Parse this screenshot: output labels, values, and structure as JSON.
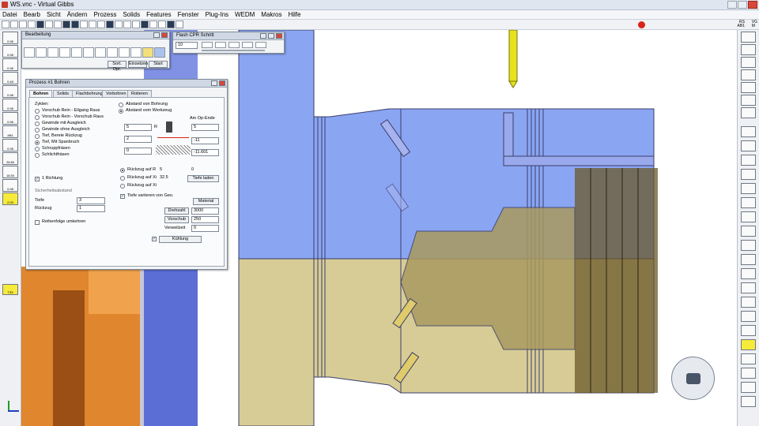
{
  "window": {
    "title": "WS.vnc - Virtual Gibbs"
  },
  "menu": [
    "Datei",
    "Bearb",
    "Sicht",
    "Ändern",
    "Prozess",
    "Solids",
    "Features",
    "Fenster",
    "Plug-Ins",
    "WEDM",
    "Makros",
    "Hilfe"
  ],
  "status": {
    "line1": "RS",
    "line2": "AB1",
    "line3": "VG",
    "line4": "M"
  },
  "left_tools": [
    {
      "label": "0.98"
    },
    {
      "label": "0.98"
    },
    {
      "label": "0.98"
    },
    {
      "label": "0.48"
    },
    {
      "label": "0.98"
    },
    {
      "label": "0.98"
    },
    {
      "label": "0.98"
    },
    {
      "label": "AB1"
    },
    {
      "label": "0.98"
    },
    {
      "label": "26.80"
    },
    {
      "label": "18.50"
    },
    {
      "label": "0.98"
    },
    {
      "label": "2.00"
    }
  ],
  "tool_indicator": {
    "label": "T33"
  },
  "bearbeitung": {
    "title": "Bearbeitung",
    "sort_label": "Sort. Opr.",
    "insert_label": "Einsetzen",
    "start_label": "Start"
  },
  "flash_panel": {
    "title": "Flash CPR Schritt",
    "speed": "10"
  },
  "prozess": {
    "title": "Prozess #1 Bohren",
    "tabs": [
      "Bohren",
      "Solids",
      "Flachbohrung",
      "Vorbohren",
      "Rotieren"
    ],
    "zyklen_label": "Zyklen:",
    "cycles": [
      "Vorschub Rein - Eilgang Raus",
      "Vorschub Rein - Vorschub Raus",
      "Gewinde mit Ausgleich",
      "Gewinde ohne Ausgleich",
      "Tief, Bereie Rückzug",
      "Tief, Mit Spanbruch",
      "Schruppfräsen",
      "Schlichtfräsen"
    ],
    "selected_cycle": 5,
    "abstand_options": [
      "Abstand von Bohrung",
      "Abstand vom Werkzeug"
    ],
    "abstand_selected": 1,
    "an_op_ende": "Am Op-Ende",
    "field_a_value": "5",
    "field_a_label": "R",
    "field_b_value": "2",
    "field_c_value": "0",
    "field_right1": "5",
    "field_right2": "-11",
    "field_right3": "-11.601",
    "einrichtung_label": "1 Richtung",
    "sicherheitsabstand_label": "Sicherheitsabstand",
    "tiefe_label": "Tiefe",
    "tiefe_value": "3",
    "rueckzug_label": "Rückzug",
    "rueckzug_value": "1",
    "reihenfolge_label": "Reihenfolge umkehren",
    "rz_options": [
      {
        "label": "Rückzug auf R",
        "value": "5"
      },
      {
        "label": "Rückzug auf Xi",
        "value": "32.5"
      },
      {
        "label": "Rückzug auf Xi",
        "value": ""
      }
    ],
    "rz_extra": "0",
    "tiefe_laden": "Tiefe laden",
    "tiefe_variieren": "Tiefe variieren von Geo.",
    "material_label": "Material",
    "drehzahl_label": "Drehzahl",
    "drehzahl_value": "3000",
    "vorschub_label": "Vorschub",
    "vorschub_value": "250",
    "verweilzeit_label": "Verweilzeit",
    "verweilzeit_value": "0",
    "kuehlung_label": "Kühlung"
  },
  "colors": {
    "blue_face": "#8aa5f2",
    "gold_face": "#d8cc96",
    "orange": "#e0862e",
    "panel": "#f3f4f6"
  }
}
